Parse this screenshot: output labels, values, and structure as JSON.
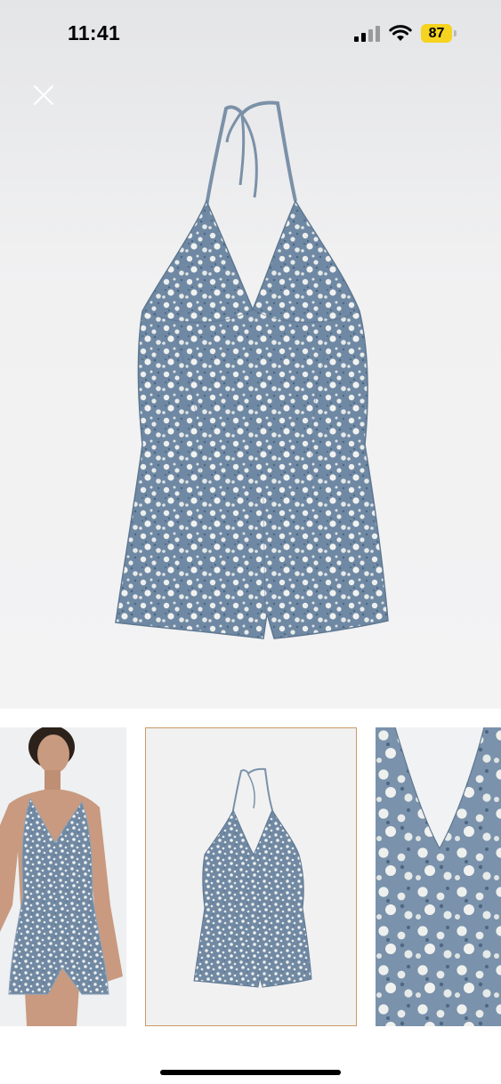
{
  "status_bar": {
    "time": "11:41",
    "battery_level": "87",
    "battery_color": "#f5d31f"
  },
  "viewer": {
    "close_icon": "close-icon",
    "selected_thumbnail_index": 1,
    "selected_border_color": "#c99a63"
  },
  "product": {
    "print_colors": {
      "base": "#6f88a3",
      "dark": "#4d6681",
      "flower": "#eef0ee"
    }
  },
  "thumbnails": [
    {
      "name": "thumbnail-model"
    },
    {
      "name": "thumbnail-product"
    },
    {
      "name": "thumbnail-detail"
    }
  ]
}
